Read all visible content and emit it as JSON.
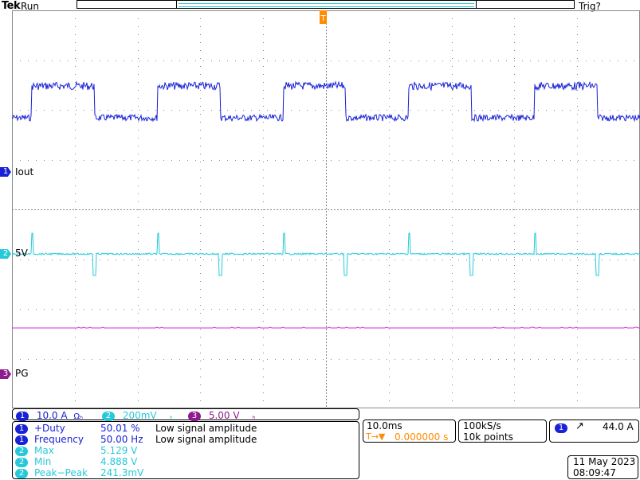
{
  "header": {
    "brand": "Tek",
    "run_state": "Run",
    "trigger_state": "Trig?"
  },
  "channels": {
    "ch1": {
      "badge": "1",
      "label": "Iout",
      "color": "#1a22d6"
    },
    "ch2": {
      "badge": "2",
      "label": "5V",
      "color": "#27c9d8"
    },
    "ch3": {
      "badge": "3",
      "label": "PG",
      "color": "#d42fd6"
    }
  },
  "trigger_marker": "T",
  "scale": {
    "ch1": {
      "badge": "1",
      "value": "10.0 A",
      "suffix": "Ωₕ"
    },
    "ch2": {
      "badge": "2",
      "value": "200mV",
      "suffix": "ₕ"
    },
    "ch3": {
      "badge": "3",
      "value": "5.00 V",
      "suffix": "ₕ"
    }
  },
  "measurements": [
    {
      "badge": "1",
      "name": "+Duty",
      "value": "50.01 %",
      "note": "Low signal amplitude"
    },
    {
      "badge": "1",
      "name": "Frequency",
      "value": "50.00 Hz",
      "note": "Low signal amplitude"
    },
    {
      "badge": "2",
      "name": "Max",
      "value": "5.129 V",
      "note": ""
    },
    {
      "badge": "2",
      "name": "Min",
      "value": "4.888 V",
      "note": ""
    },
    {
      "badge": "2",
      "name": "Peak−Peak",
      "value": "241.3mV",
      "note": ""
    }
  ],
  "timebase": {
    "div": "10.0ms",
    "position_marker": "T→▼",
    "position": "0.000000 s"
  },
  "acquisition": {
    "rate": "100kS/s",
    "points": "10k points"
  },
  "trigger": {
    "badge": "1",
    "slope": "↗",
    "level": "44.0 A"
  },
  "datetime": {
    "date": "11 May 2023",
    "time": "08:09:47"
  }
}
